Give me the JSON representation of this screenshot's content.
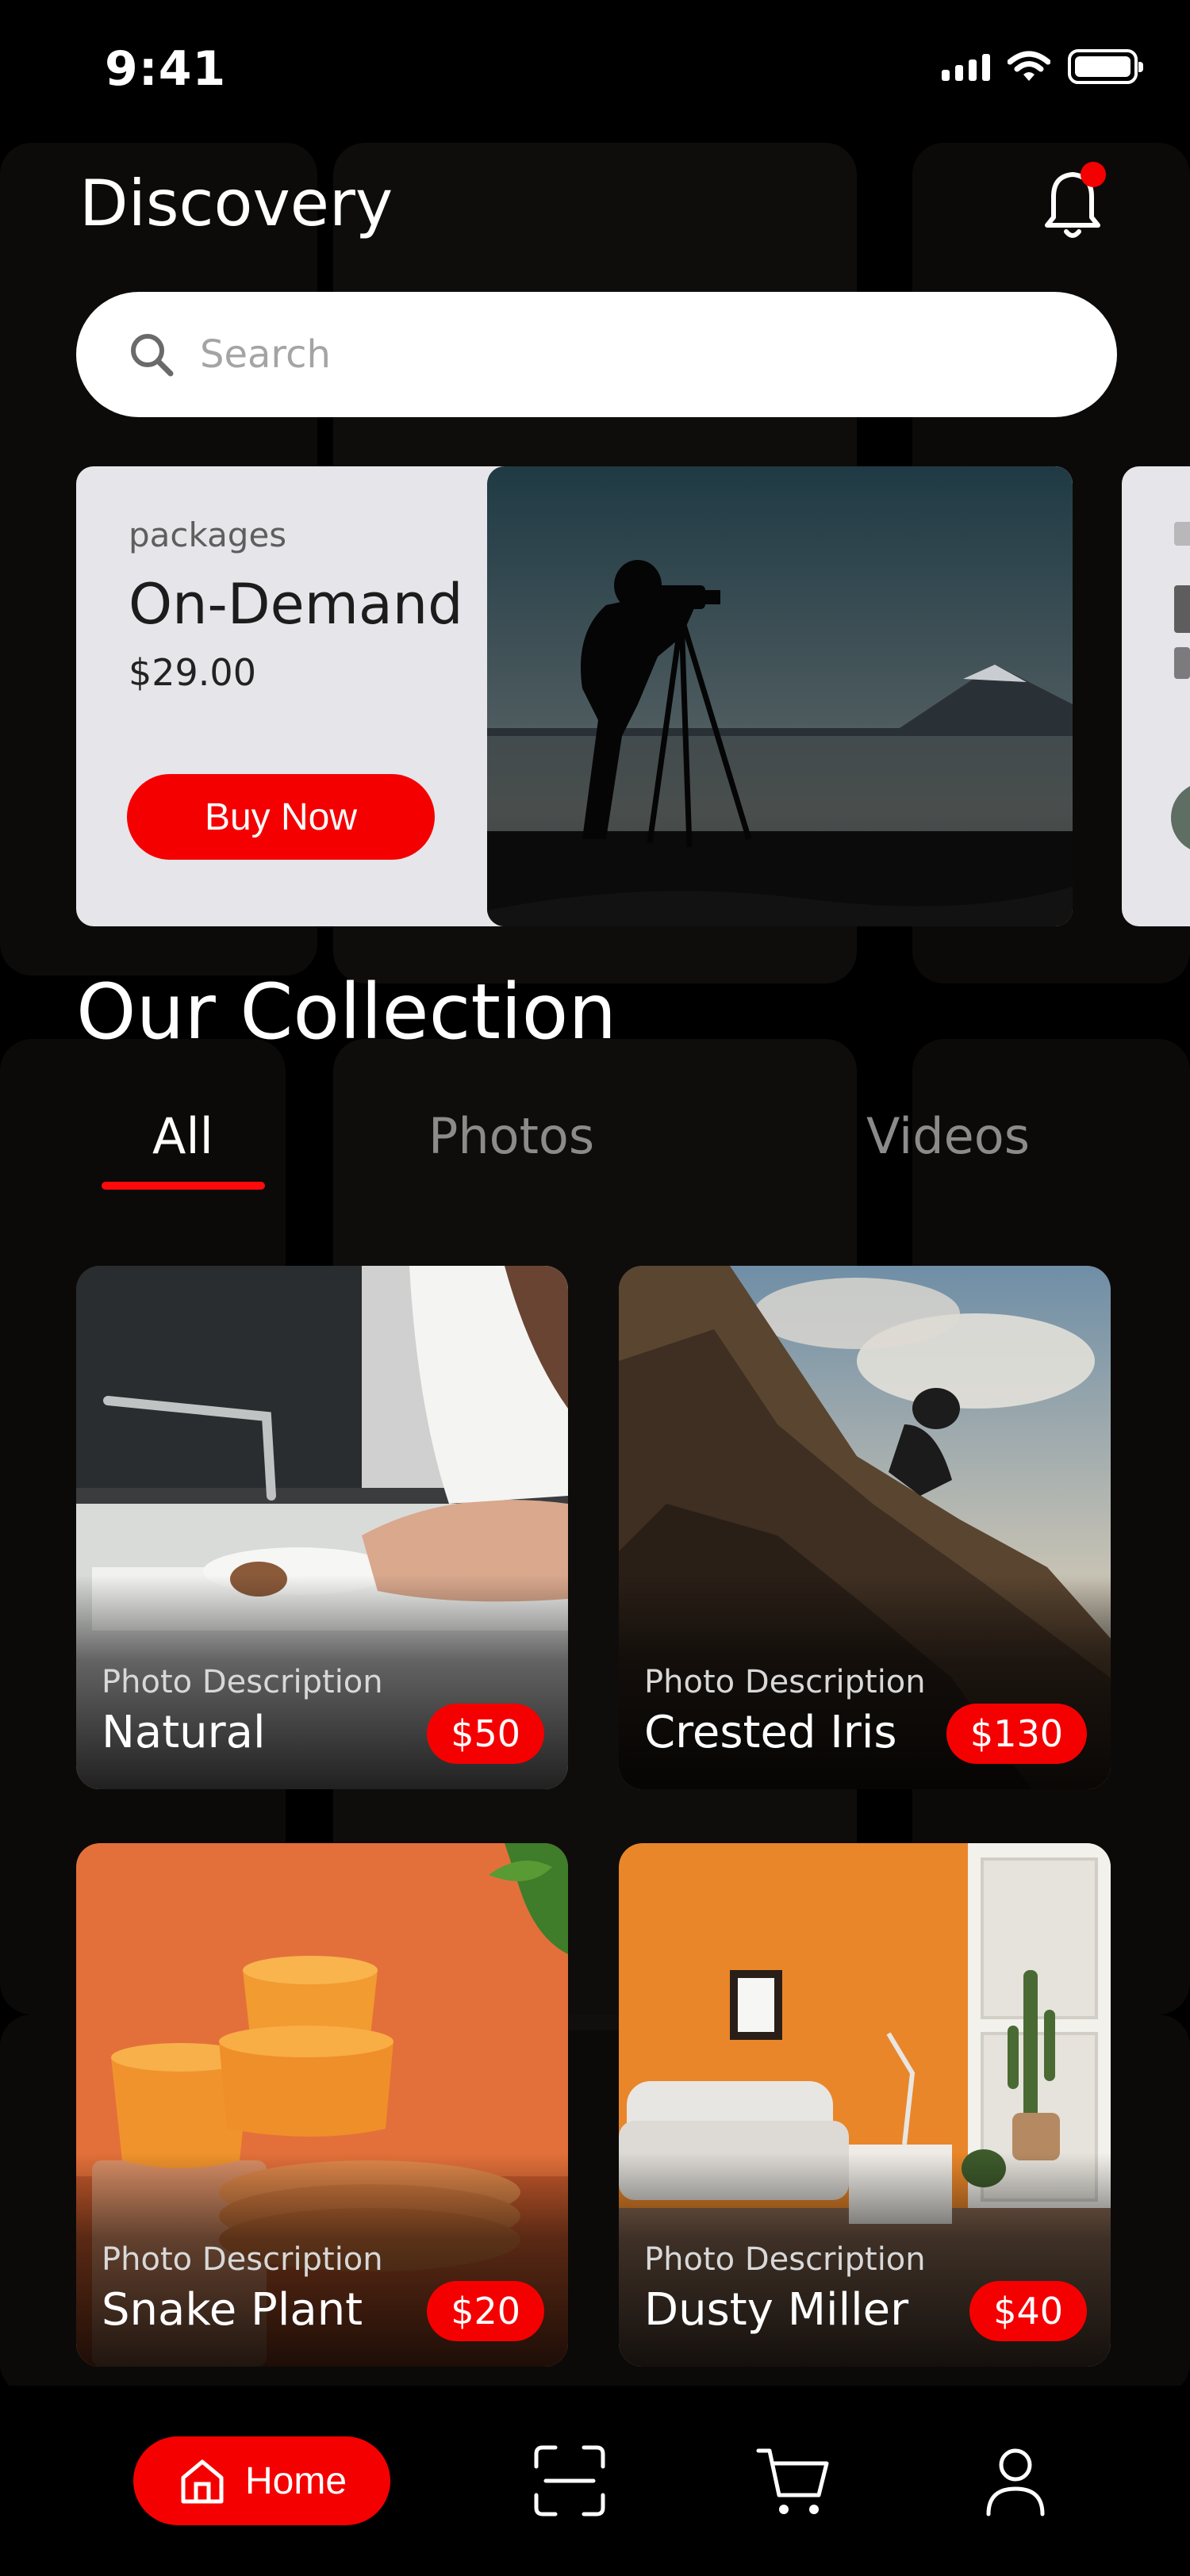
{
  "status_bar": {
    "time": "9:41"
  },
  "header": {
    "title": "Discovery"
  },
  "search": {
    "placeholder": "Search"
  },
  "promo": {
    "kicker": "packages",
    "name": "On-Demand",
    "price": "$29.00",
    "button_label": "Buy Now"
  },
  "collection": {
    "title": "Our Collection",
    "tabs": [
      {
        "label": "All",
        "active": true
      },
      {
        "label": "Photos",
        "active": false
      },
      {
        "label": "Videos",
        "active": false
      }
    ],
    "items": [
      {
        "description": "Photo Description",
        "name": "Natural",
        "price": "$50"
      },
      {
        "description": "Photo Description",
        "name": "Crested Iris",
        "price": "$130"
      },
      {
        "description": "Photo Description",
        "name": "Snake Plant",
        "price": "$20"
      },
      {
        "description": "Photo Description",
        "name": "Dusty Miller",
        "price": "$40"
      }
    ]
  },
  "bottom_nav": {
    "home_label": "Home",
    "icons": [
      "home-icon",
      "scan-icon",
      "cart-icon",
      "profile-icon"
    ]
  },
  "colors": {
    "accent": "#f50000",
    "background": "#000000",
    "card_surface": "#e6e6ea"
  }
}
